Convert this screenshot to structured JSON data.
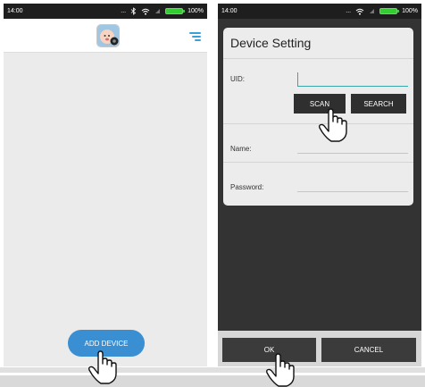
{
  "left_screen": {
    "status": {
      "time": "14:00",
      "dots": "...",
      "battery": "100%"
    },
    "header": {
      "logo_icon": "baby-face-icon",
      "menu_icon": "menu-lines-icon"
    },
    "add_device_label": "ADD DEVICE"
  },
  "right_screen": {
    "status": {
      "time": "14:00",
      "dots": "...",
      "battery": "100%"
    },
    "dialog": {
      "title": "Device Setting",
      "uid_label": "UID:",
      "uid_value": "",
      "scan_label": "SCAN",
      "search_label": "SEARCH",
      "name_label": "Name:",
      "name_value": "",
      "password_label": "Password:",
      "password_value": ""
    },
    "ok_label": "OK",
    "cancel_label": "CANCEL"
  },
  "colors": {
    "accent_blue": "#3a8ed2",
    "menu_blue": "#3aa0d8",
    "uid_underline": "#39a7a7",
    "battery_green": "#33cc33"
  },
  "icons": [
    "hand-pointer-icon",
    "wifi-icon",
    "bluetooth-icon",
    "battery-icon"
  ]
}
